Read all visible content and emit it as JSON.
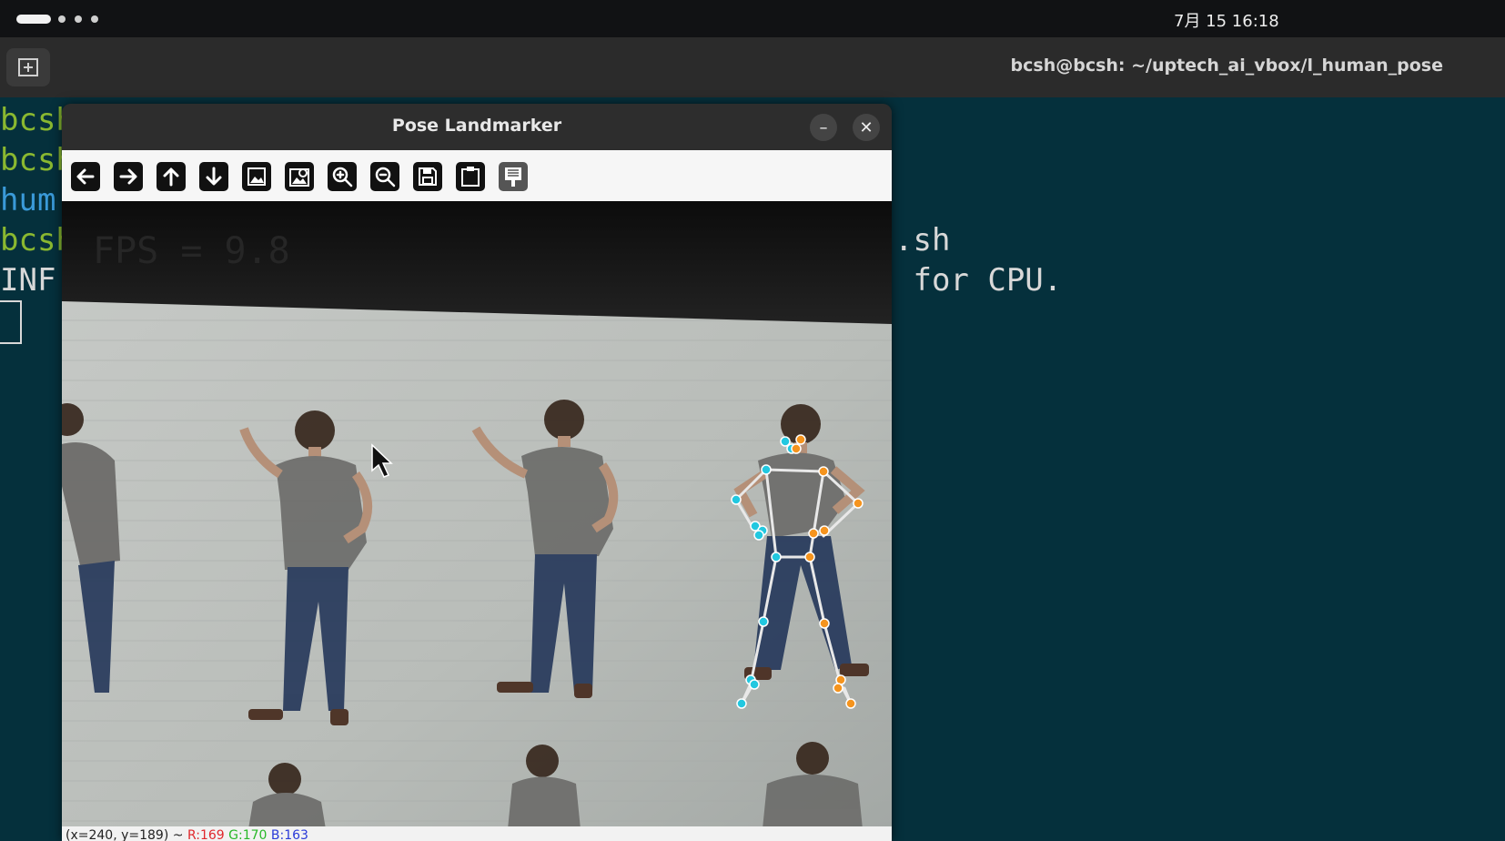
{
  "topbar": {
    "clock": "7月 15  16:18"
  },
  "terminal": {
    "title": "bcsh@bcsh: ~/uptech_ai_vbox/l_human_pose",
    "new_tab_icon": "new-tab-icon",
    "lines": [
      {
        "left": "bcsh",
        "right": ""
      },
      {
        "left": "bcsh",
        "right": ""
      },
      {
        "left": "hum",
        "right": ""
      },
      {
        "left": "bcsh",
        "right": ".sh"
      },
      {
        "left": "INF",
        "right": " for CPU."
      }
    ]
  },
  "window": {
    "title": "Pose Landmarker",
    "minimize": "–",
    "close": "✕",
    "toolbar": [
      "pan-left-icon",
      "pan-right-icon",
      "pan-up-icon",
      "pan-down-icon",
      "zoom-fit-icon",
      "zoom-original-icon",
      "zoom-in-icon",
      "zoom-out-icon",
      "save-icon",
      "copy-clipboard-icon",
      "properties-icon"
    ],
    "overlay_text": "FPS = 9.8",
    "status": {
      "coord": "(x=240, y=189) ~ ",
      "r": "R:169",
      "g": "G:170",
      "b": "B:163"
    }
  },
  "colors": {
    "left_landmark": "#22c8e0",
    "right_landmark": "#f5941e",
    "skeleton": "#e8e8e8",
    "terminal_bg": "#05303c"
  }
}
